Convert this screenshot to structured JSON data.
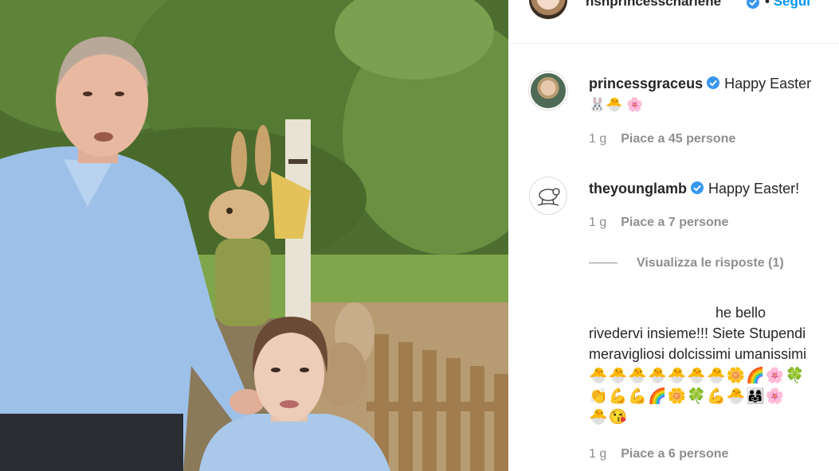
{
  "post_header": {
    "username": "hshprincesscharlene",
    "separator": "•",
    "follow_label": "Segui"
  },
  "comments": [
    {
      "username": "princessgraceus",
      "text": "Happy Easter",
      "emoji": "🐰🐣 🌸",
      "time": "1 g",
      "likes": "Piace a 45 persone"
    },
    {
      "username": "theyounglamb",
      "text": "Happy Easter!",
      "time": "1 g",
      "likes": "Piace a 7 persone"
    }
  ],
  "view_replies": "Visualizza le risposte (1)",
  "reply": {
    "text_line1": "he bello",
    "text_line2": "rivedervi insieme!!! Siete Stupendi",
    "text_line3": "meravigliosi dolcissimi umanissimi",
    "emoji_line1": "🐣🐣🐣🐣🐣🐣🐣🌼🌈🌸🍀",
    "emoji_line2": "👏💪💪🌈🌼🍀💪🐣👨‍👩‍👧🌸",
    "emoji_line3": "🐣😘",
    "time": "1 g",
    "likes": "Piace a 6 persone"
  },
  "colors": {
    "link_blue": "#0095f6",
    "verified_blue": "#3897f0",
    "secondary_text": "#8e8e8e",
    "primary_text": "#262626"
  }
}
